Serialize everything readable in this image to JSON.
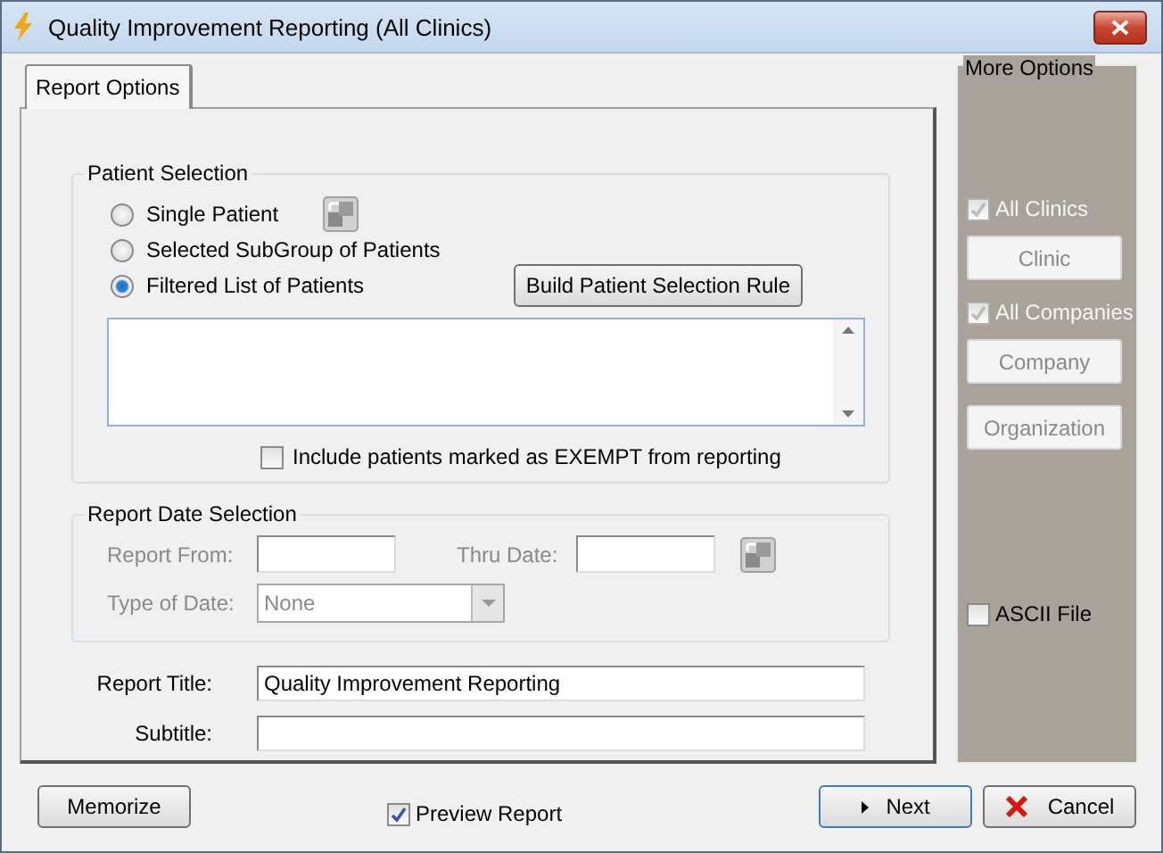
{
  "window": {
    "title": "Quality Improvement Reporting (All Clinics)"
  },
  "tabs": [
    {
      "label": "Report Options",
      "selected": true
    }
  ],
  "patient_selection": {
    "legend": "Patient Selection",
    "options": [
      {
        "label": "Single Patient",
        "selected": false,
        "has_picker": true
      },
      {
        "label": "Selected SubGroup of Patients",
        "selected": false
      },
      {
        "label": "Filtered List of Patients",
        "selected": true,
        "action": "Build Patient Selection Rule"
      }
    ],
    "exempt": {
      "label": "Include patients marked as EXEMPT from reporting",
      "checked": false
    }
  },
  "report_date": {
    "legend": "Report Date Selection",
    "disabled": true,
    "from_label": "Report From:",
    "thru_label": "Thru Date:",
    "type_label": "Type of Date:",
    "type_value": "None"
  },
  "report_title": {
    "label": "Report Title:",
    "value": "Quality Improvement Reporting"
  },
  "subtitle": {
    "label": "Subtitle:"
  },
  "more_options": {
    "legend": "More Options",
    "items": [
      {
        "kind": "checkbox",
        "label": "All Clinics",
        "checked": true,
        "disabled": true
      },
      {
        "kind": "button",
        "label": "Clinic",
        "disabled": true
      },
      {
        "kind": "checkbox",
        "label": "All Companies",
        "checked": true,
        "disabled": true
      },
      {
        "kind": "button",
        "label": "Company",
        "disabled": true
      },
      {
        "kind": "button",
        "label": "Organization",
        "disabled": true
      }
    ],
    "ascii": {
      "label": "ASCII File",
      "checked": false
    }
  },
  "footer": {
    "memorize": "Memorize",
    "preview": {
      "label": "Preview Report",
      "checked": true
    },
    "next": "Next",
    "cancel": "Cancel"
  }
}
